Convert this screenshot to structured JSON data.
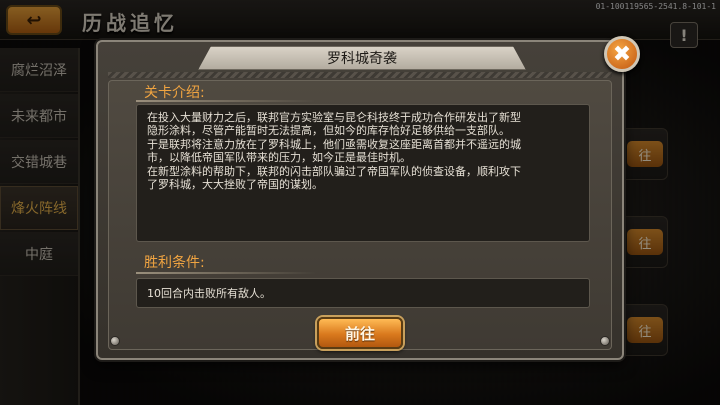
{
  "header": {
    "back_label": "↩",
    "title": "历战追忆",
    "debug_id": "01-100119565-2541.8-101-1",
    "alert_label": "!"
  },
  "sidebar": {
    "items": [
      {
        "label": "腐烂沼泽"
      },
      {
        "label": "未来都市"
      },
      {
        "label": "交错城巷"
      },
      {
        "label": "烽火阵线"
      },
      {
        "label": "中庭"
      }
    ],
    "active_index": 3
  },
  "background_cards": {
    "go_label": "往"
  },
  "dialog": {
    "title": "罗科城奇袭",
    "close_label": "✖",
    "intro_heading": "关卡介绍:",
    "intro_lines": [
      "在投入大量财力之后，联邦官方实验室与昆仑科技终于成功合作研发出了新型",
      "隐形涂料，尽管产能暂时无法提高，但如今的库存恰好足够供给一支部队。",
      "于是联邦将注意力放在了罗科城上，他们亟需收复这座距离首都并不遥远的城",
      "市，以降低帝国军队带来的压力，如今正是最佳时机。",
      "在新型涂料的帮助下，联邦的闪击部队骗过了帝国军队的侦查设备，顺利攻下",
      "了罗科城，大大挫败了帝国的谋划。"
    ],
    "victory_heading": "胜利条件:",
    "victory_text": "10回合内击败所有敌人。",
    "go_button": "前往"
  },
  "colors": {
    "accent_orange": "#f0a441",
    "button_orange": "#d9791d",
    "panel": "#46413a"
  }
}
